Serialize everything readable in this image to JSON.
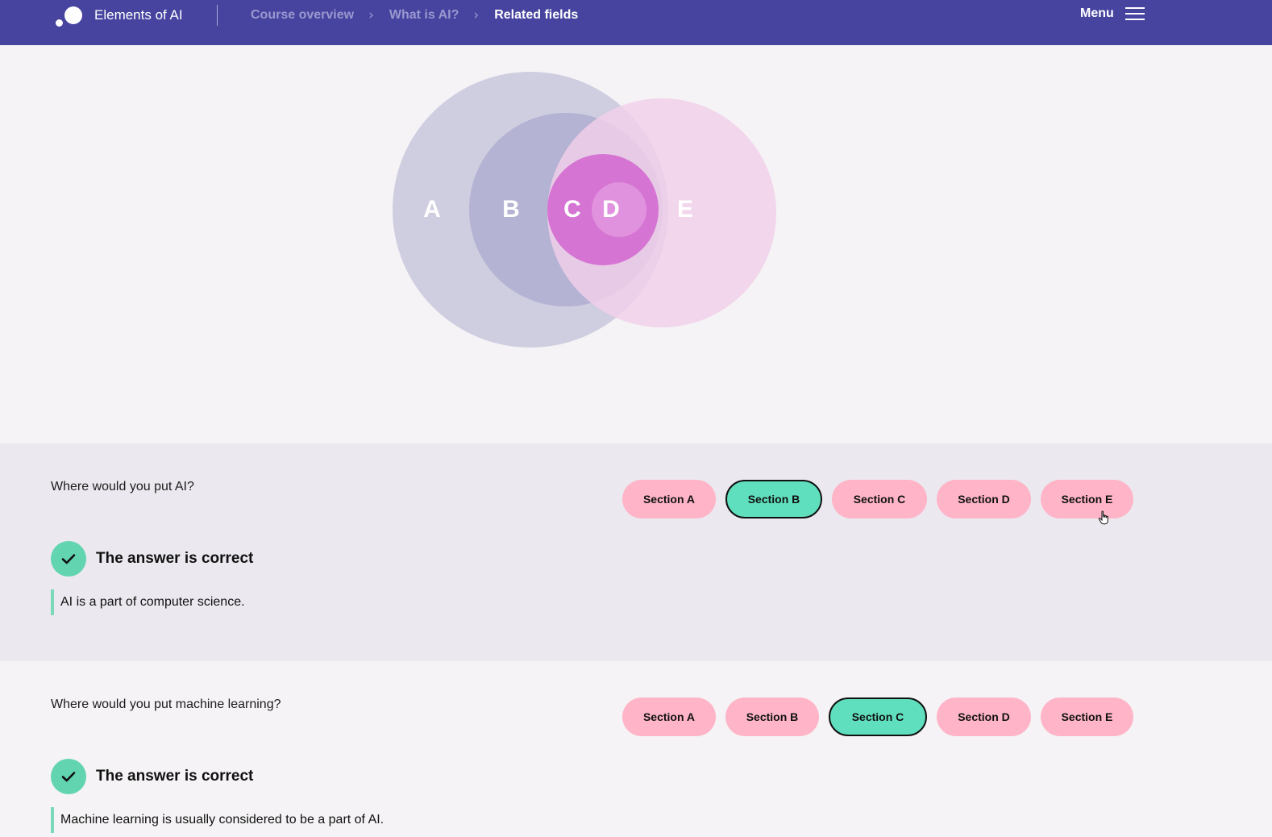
{
  "header": {
    "brand": "Elements of AI",
    "breadcrumbs": [
      {
        "label": "Course overview"
      },
      {
        "label": "What is AI?"
      },
      {
        "label": "Related fields"
      }
    ],
    "menu_label": "Menu"
  },
  "venn": {
    "labels": [
      "A",
      "B",
      "C",
      "D",
      "E"
    ],
    "colors": {
      "outer": "#cfcde0",
      "middle": "#b4b3d3",
      "right": "#f2cfea",
      "inner": "#d574d2",
      "core": "#e192de"
    }
  },
  "questions": [
    {
      "question": "Where would you put AI?",
      "options": [
        "Section A",
        "Section B",
        "Section C",
        "Section D",
        "Section E"
      ],
      "selected": "Section B",
      "feedback": "The answer is correct",
      "explanation": "AI is a part of computer science."
    },
    {
      "question": "Where would you put machine learning?",
      "options": [
        "Section A",
        "Section B",
        "Section C",
        "Section D",
        "Section E"
      ],
      "selected": "Section C",
      "feedback": "The answer is correct",
      "explanation": "Machine learning is usually considered to be a part of AI."
    }
  ],
  "colors": {
    "header_bg": "#4744a0",
    "option_bg": "#ffb4c8",
    "option_selected_bg": "#5fdfbd",
    "check_green": "#62d5b0"
  },
  "icons": {
    "logo": "two-dots-logo",
    "menu": "hamburger-icon",
    "breadcrumb_separator": "chevron-right-icon",
    "correct": "checkmark-icon",
    "cursor": "hand-pointer-icon"
  }
}
